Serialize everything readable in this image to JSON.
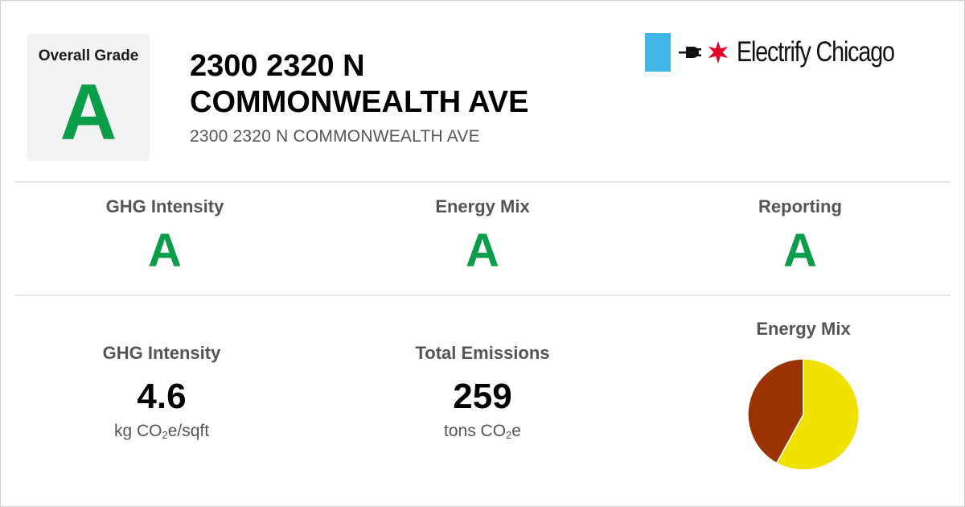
{
  "overall": {
    "label": "Overall Grade",
    "grade": "A"
  },
  "building": {
    "title": "2300 2320 N COMMONWEALTH AVE",
    "address": "2300 2320 N COMMONWEALTH AVE"
  },
  "brand": {
    "name": "Electrify Chicago",
    "icons": [
      "flag-blue-bar",
      "plug-icon",
      "red-star-icon"
    ]
  },
  "grades": [
    {
      "label": "GHG Intensity",
      "grade": "A"
    },
    {
      "label": "Energy Mix",
      "grade": "A"
    },
    {
      "label": "Reporting",
      "grade": "A"
    }
  ],
  "metrics": {
    "ghg_intensity": {
      "label": "GHG Intensity",
      "value": "4.6",
      "unit_prefix": "kg CO",
      "unit_sub": "2",
      "unit_suffix": "e/sqft"
    },
    "total_emissions": {
      "label": "Total Emissions",
      "value": "259",
      "unit_prefix": "tons CO",
      "unit_sub": "2",
      "unit_suffix": "e"
    },
    "energy_mix_label": "Energy Mix"
  },
  "colors": {
    "grade_green": "#0a9e4a",
    "electric": "#f0e100",
    "gas": "#9a3300",
    "brand_blue": "#41b6e6",
    "brand_red": "#e4002b"
  },
  "chart_data": {
    "type": "pie",
    "title": "Energy Mix",
    "slices": [
      {
        "value": 58,
        "color": "#f0e100"
      },
      {
        "value": 42,
        "color": "#9a3300"
      }
    ]
  }
}
